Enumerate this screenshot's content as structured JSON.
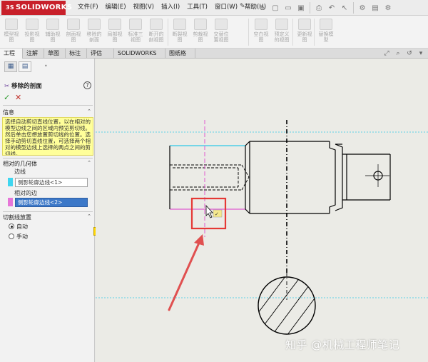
{
  "app": {
    "brand": "SOLIDWORKS",
    "brand_mark": "3S"
  },
  "menu": [
    {
      "label": "文件(F)"
    },
    {
      "label": "编辑(E)"
    },
    {
      "label": "视图(V)"
    },
    {
      "label": "插入(I)"
    },
    {
      "label": "工具(T)"
    },
    {
      "label": "窗口(W)"
    },
    {
      "label": "帮助(H)"
    }
  ],
  "toolbar_icons": [
    "home-icon",
    "new-document-icon",
    "open-icon",
    "save-icon",
    "print-icon",
    "undo-icon",
    "select-icon",
    "rebuild-icon",
    "file-properties-icon",
    "options-icon"
  ],
  "command_manager": [
    {
      "label": "模型视\n图"
    },
    {
      "label": "投影视\n图"
    },
    {
      "label": "辅助视\n图"
    },
    {
      "label": "剖面视\n图"
    },
    {
      "label": "移除的\n剖面"
    },
    {
      "label": "局部视\n图"
    },
    {
      "label": "标准三\n视图"
    },
    {
      "label": "断开的\n剖视图"
    },
    {
      "label": "断裂视\n图"
    },
    {
      "label": "剪裁视\n图"
    },
    {
      "label": "交替位\n置视图"
    },
    {
      "label": "空白视\n图"
    },
    {
      "label": "预定义\n的视图"
    },
    {
      "label": "更新视\n图"
    },
    {
      "label": "替换模\n型"
    }
  ],
  "tabs": [
    {
      "label": "工程图",
      "active": true
    },
    {
      "label": "注解",
      "active": false
    },
    {
      "label": "草图",
      "active": false
    },
    {
      "label": "标注",
      "active": false
    },
    {
      "label": "评估",
      "active": false
    },
    {
      "label": "SOLIDWORKS 插件",
      "active": false
    },
    {
      "label": "图纸格式",
      "active": false
    }
  ],
  "property_manager": {
    "title": "移除的剖面",
    "help": "?",
    "ok": "✓",
    "cancel": "✕",
    "info_heading": "信息",
    "info_text": "选择自动剪切直线位置，以在相对的模型边线之间的区域内预览剪切线。然后单击您想放置剪切线的位置。选择手动剪切直线位置，可选择两个相对的模型边线上选择的两点之间的剪切线。",
    "geometry_heading": "相对的几何体",
    "edge_label": "边线",
    "edge_value": "侧影轮廓边线<1>",
    "opposite_label": "相对的边",
    "opposite_value": "侧影轮廓边线<2>",
    "cutline_heading": "切割线放置",
    "radio_auto": "自动",
    "radio_manual": "手动",
    "auto_selected": true
  },
  "colors": {
    "brand_red": "#c8202a",
    "swatch_edge": "#3fd6f0",
    "swatch_opposite": "#e676d8",
    "cyan_line": "#2ec8e8",
    "magenta_line": "#e05ad0",
    "highlight_box": "#e53935",
    "arrow": "#e05050"
  },
  "watermark": "知乎 @机械工程师笔记"
}
